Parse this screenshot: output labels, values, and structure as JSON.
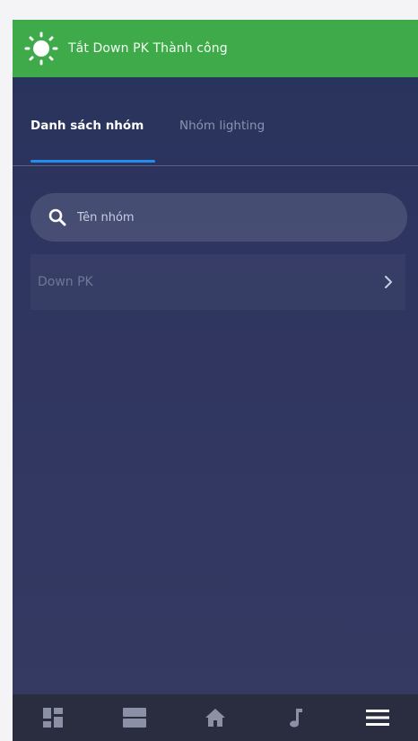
{
  "toast": {
    "message": "Tắt Down PK Thành công",
    "icon": "sun-icon",
    "background": "#3faa4a"
  },
  "tabs": [
    {
      "label": "Danh sách nhóm",
      "active": true
    },
    {
      "label": "Nhóm lighting",
      "active": false
    }
  ],
  "search": {
    "placeholder": "Tên nhóm",
    "value": "",
    "icon": "search-icon"
  },
  "groups": [
    {
      "name": "Down PK",
      "icon": "chevron-right-icon"
    }
  ],
  "bottom_nav": [
    {
      "icon": "dashboard-icon"
    },
    {
      "icon": "rooms-icon"
    },
    {
      "icon": "home-icon"
    },
    {
      "icon": "music-icon"
    },
    {
      "icon": "menu-icon"
    }
  ],
  "colors": {
    "accent": "#1f8ef0",
    "background": "#2e3560",
    "nav_background": "#2a2c3f",
    "toast": "#3faa4a"
  }
}
